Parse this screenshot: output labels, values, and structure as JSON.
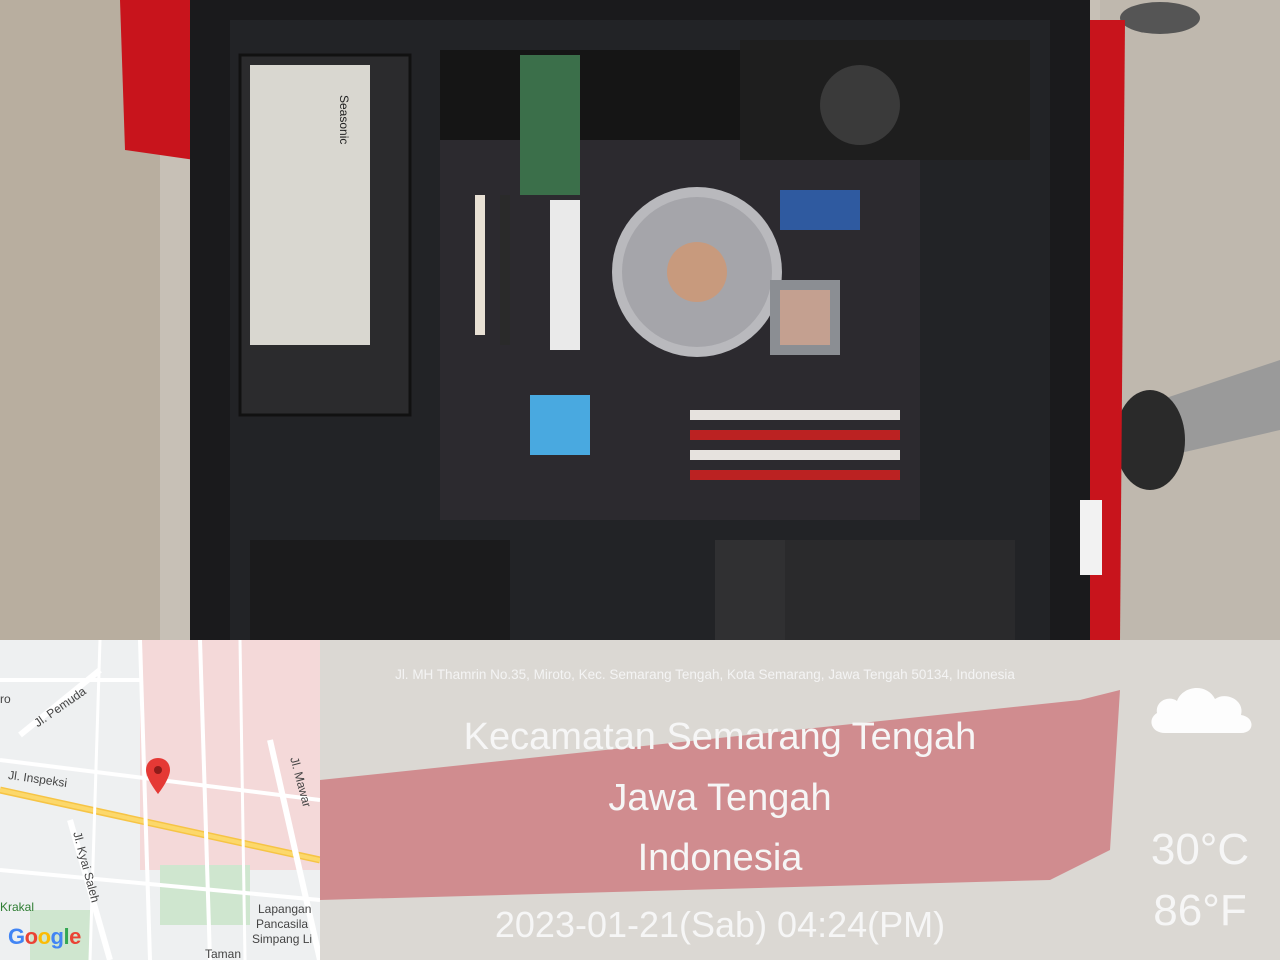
{
  "stamp": {
    "address": "Jl. MH Thamrin No.35, Miroto, Kec. Semarang Tengah, Kota Semarang, Jawa Tengah 50134, Indonesia",
    "district": "Kecamatan Semarang Tengah",
    "province": "Jawa Tengah",
    "country": "Indonesia",
    "datetime": "2023-01-21(Sab)   04:24(PM)",
    "temp_c": "30°C",
    "temp_f": "86°F",
    "weather_icon": "cloud-icon"
  },
  "map": {
    "labels": [
      "Jl. Pemuda",
      "Jl. Inspeksi",
      "Jl. Mawar",
      "Jl. Kyai Saleh",
      "Krakal",
      "Lapangan",
      "Pancasila",
      "Simpang Li",
      "Taman",
      "ro"
    ],
    "logo": "Google",
    "pin_icon": "map-pin-icon"
  },
  "photo": {
    "psu_brand": "Seasonic"
  }
}
